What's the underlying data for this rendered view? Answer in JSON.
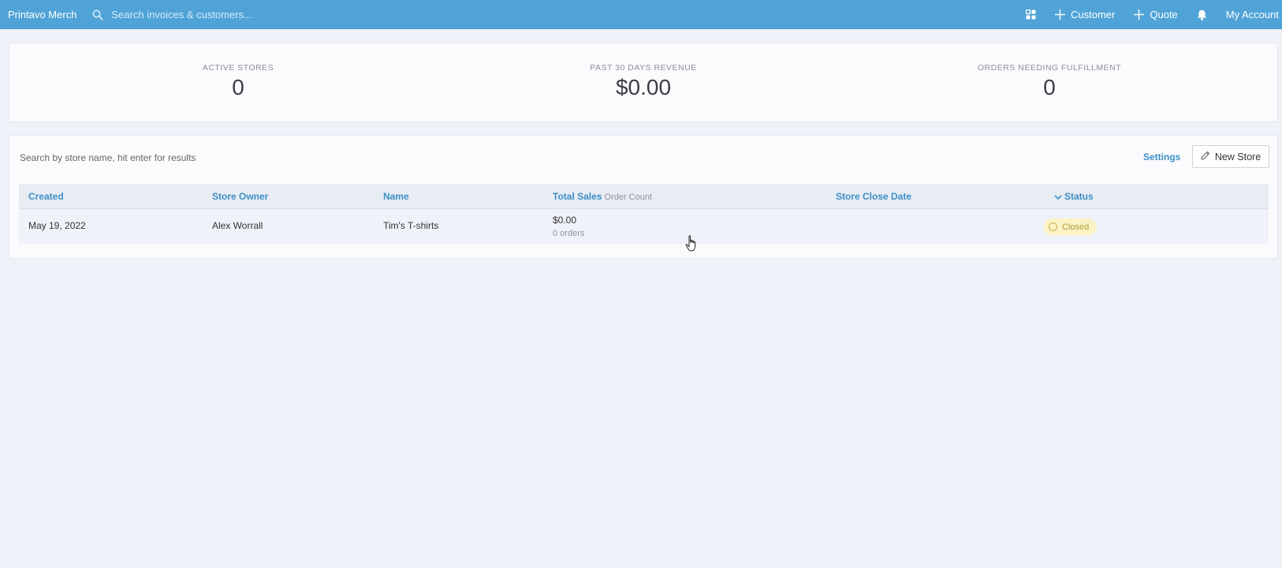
{
  "topbar": {
    "brand": "Printavo Merch",
    "search_placeholder": "Search invoices & customers...",
    "customer_label": "Customer",
    "quote_label": "Quote",
    "account_label": "My Account"
  },
  "stats": [
    {
      "label": "ACTIVE STORES",
      "value": "0"
    },
    {
      "label": "PAST 30 DAYS REVENUE",
      "value": "$0.00"
    },
    {
      "label": "ORDERS NEEDING FULFILLMENT",
      "value": "0"
    }
  ],
  "stores": {
    "search_placeholder": "Search by store name, hit enter for results",
    "settings_label": "Settings",
    "new_store_label": "New Store",
    "columns": {
      "created": "Created",
      "store_owner": "Store Owner",
      "name": "Name",
      "total_sales": "Total Sales",
      "order_count": "Order Count",
      "close_date": "Store Close Date",
      "status": "Status"
    },
    "rows": [
      {
        "created": "May 19, 2022",
        "owner": "Alex Worrall",
        "name": "Tim's T-shirts",
        "total_sales": "$0.00",
        "orders": "0 orders",
        "close_date": "",
        "status": "Closed"
      }
    ]
  },
  "colors": {
    "topbar": "#4fa3d7",
    "link": "#3d8fc6",
    "badge_bg": "#fbf3c4",
    "background": "#eff2f8"
  }
}
